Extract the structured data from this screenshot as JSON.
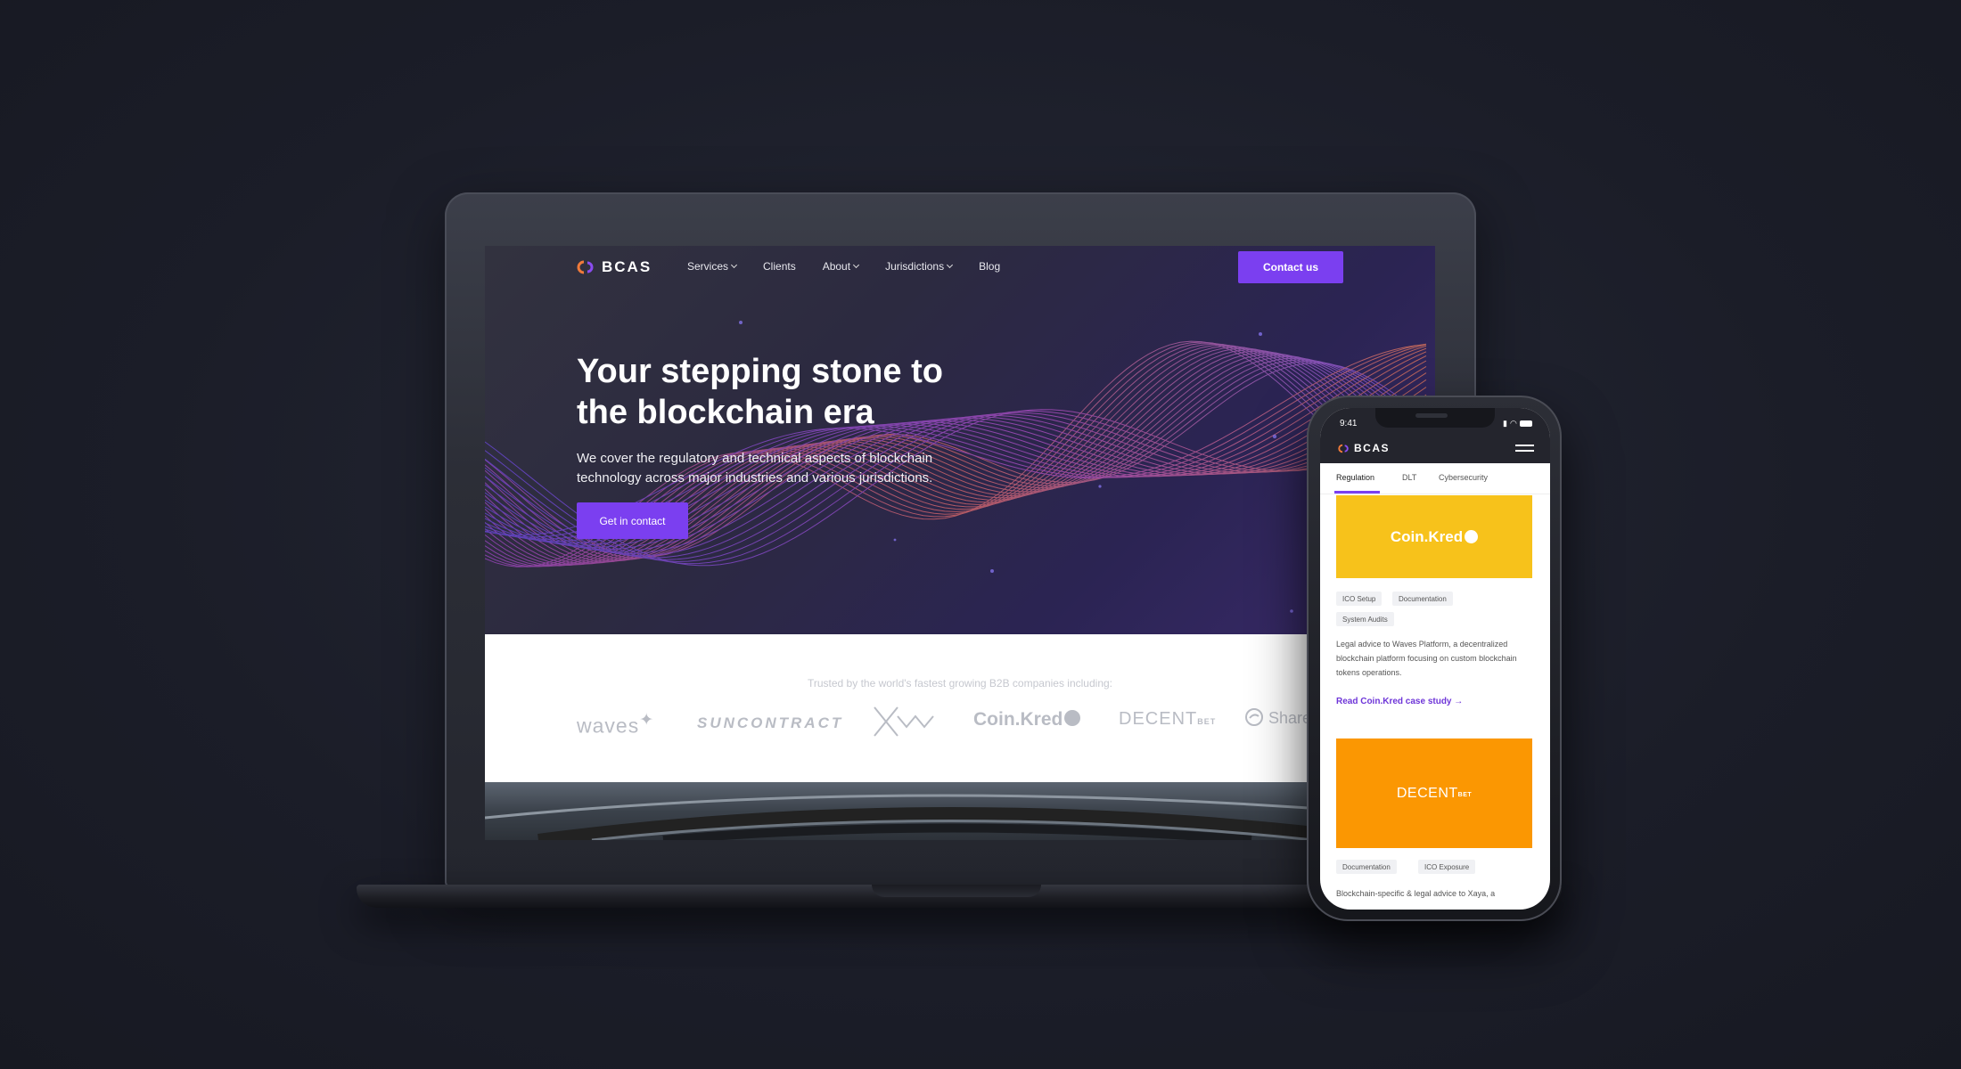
{
  "laptop_site": {
    "logo_text": "BCAS",
    "nav": {
      "services": "Services",
      "clients": "Clients",
      "about": "About",
      "jurisdictions": "Jurisdictions",
      "blog": "Blog"
    },
    "contact_button": "Contact us",
    "hero": {
      "title": "Your stepping stone to the blockchain era",
      "subtitle": "We cover the regulatory and technical aspects of blockchain technology across major industries and various jurisdictions.",
      "cta": "Get in contact"
    },
    "trusted": {
      "text": "Trusted by the world's fastest growing B2B companies including:",
      "partners": {
        "waves": "waves",
        "suncontract": "SUNCONTRACT",
        "coinkred": "Coin.Kred",
        "decent": "DECENT",
        "decent_suffix": "BET",
        "share": "Share"
      }
    }
  },
  "phone_site": {
    "time": "9:41",
    "logo_text": "BCAS",
    "tabs": [
      "Regulation",
      "DLT",
      "Cybersecurity"
    ],
    "active_tab": "Regulation",
    "card1": {
      "logo": "Coin.Kred",
      "tags": [
        "ICO Setup",
        "Documentation",
        "System Audits"
      ],
      "description": "Legal advice to Waves Platform, a decentralized blockchain platform focusing on custom blockchain tokens operations.",
      "link": "Read Coin.Kred case study →"
    },
    "card2": {
      "logo": "DECENT",
      "logo_suffix": "BET",
      "tags": [
        "Documentation",
        "ICO Exposure"
      ],
      "description": "Blockchain-specific & legal advice to Xaya, a"
    }
  },
  "colors": {
    "accent": "#7b3ff0",
    "page_bg": "#1b1d28",
    "coin_card": "#f7c21b",
    "decent_card": "#fb9702"
  }
}
